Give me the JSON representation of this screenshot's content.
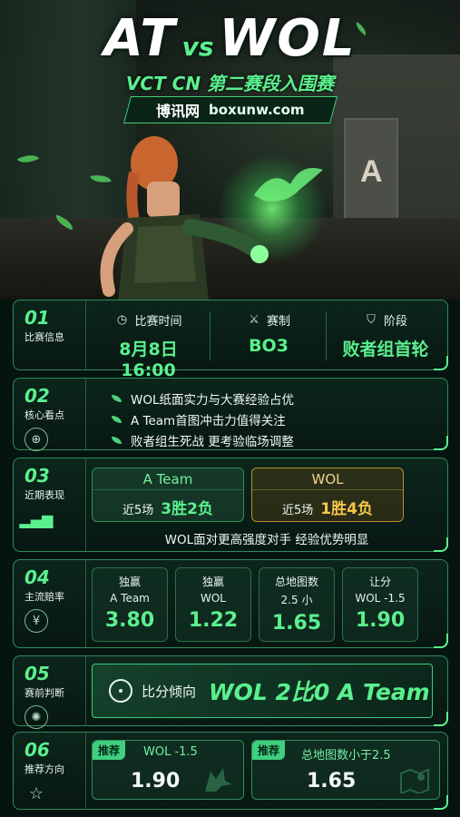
{
  "hero": {
    "team_left": "AT",
    "vs": "vs",
    "team_right": "WOL",
    "subtitle": "VCT CN 第二赛段入围赛",
    "brand_cn": "博讯网",
    "brand_url": "boxunw.com"
  },
  "sections": {
    "match_info": {
      "num": "01",
      "label": "比赛信息",
      "cols": [
        {
          "icon": "clock-icon",
          "head": "比赛时间",
          "value": "8月8日 16:00"
        },
        {
          "icon": "crossed-swords-icon",
          "head": "赛制",
          "value": "BO3"
        },
        {
          "icon": "emblem-icon",
          "head": "阶段",
          "value": "败者组首轮"
        }
      ]
    },
    "highlights": {
      "num": "02",
      "label": "核心看点",
      "items": [
        "WOL纸面实力与大赛经验占优",
        "A Team首图冲击力值得关注",
        "败者组生死战 更考验临场调整"
      ]
    },
    "recent": {
      "num": "03",
      "label": "近期表现",
      "teams": [
        {
          "name": "A Team",
          "span": "近5场",
          "record": "3胜2负"
        },
        {
          "name": "WOL",
          "span": "近5场",
          "record": "1胜4负"
        }
      ],
      "note": "WOL面对更高强度对手 经验优势明显"
    },
    "odds": {
      "num": "04",
      "label": "主流赔率",
      "items": [
        {
          "l1": "独赢",
          "l2": "A Team",
          "v": "3.80"
        },
        {
          "l1": "独赢",
          "l2": "WOL",
          "v": "1.22"
        },
        {
          "l1": "总地图数",
          "l2": "2.5 小",
          "v": "1.65"
        },
        {
          "l1": "让分",
          "l2": "WOL -1.5",
          "v": "1.90"
        }
      ]
    },
    "prediction": {
      "num": "05",
      "label": "赛前判断",
      "tag": "比分倾向",
      "result": "WOL 2比0 A Team"
    },
    "picks": {
      "num": "06",
      "label": "推荐方向",
      "items": [
        {
          "tag": "推荐",
          "what": "WOL -1.5",
          "v": "1.90"
        },
        {
          "tag": "推荐",
          "what": "总地图数小于2.5",
          "v": "1.65"
        }
      ]
    }
  },
  "colors": {
    "accent": "#5af08e",
    "gold": "#f6c54a",
    "bg": "#061410"
  }
}
